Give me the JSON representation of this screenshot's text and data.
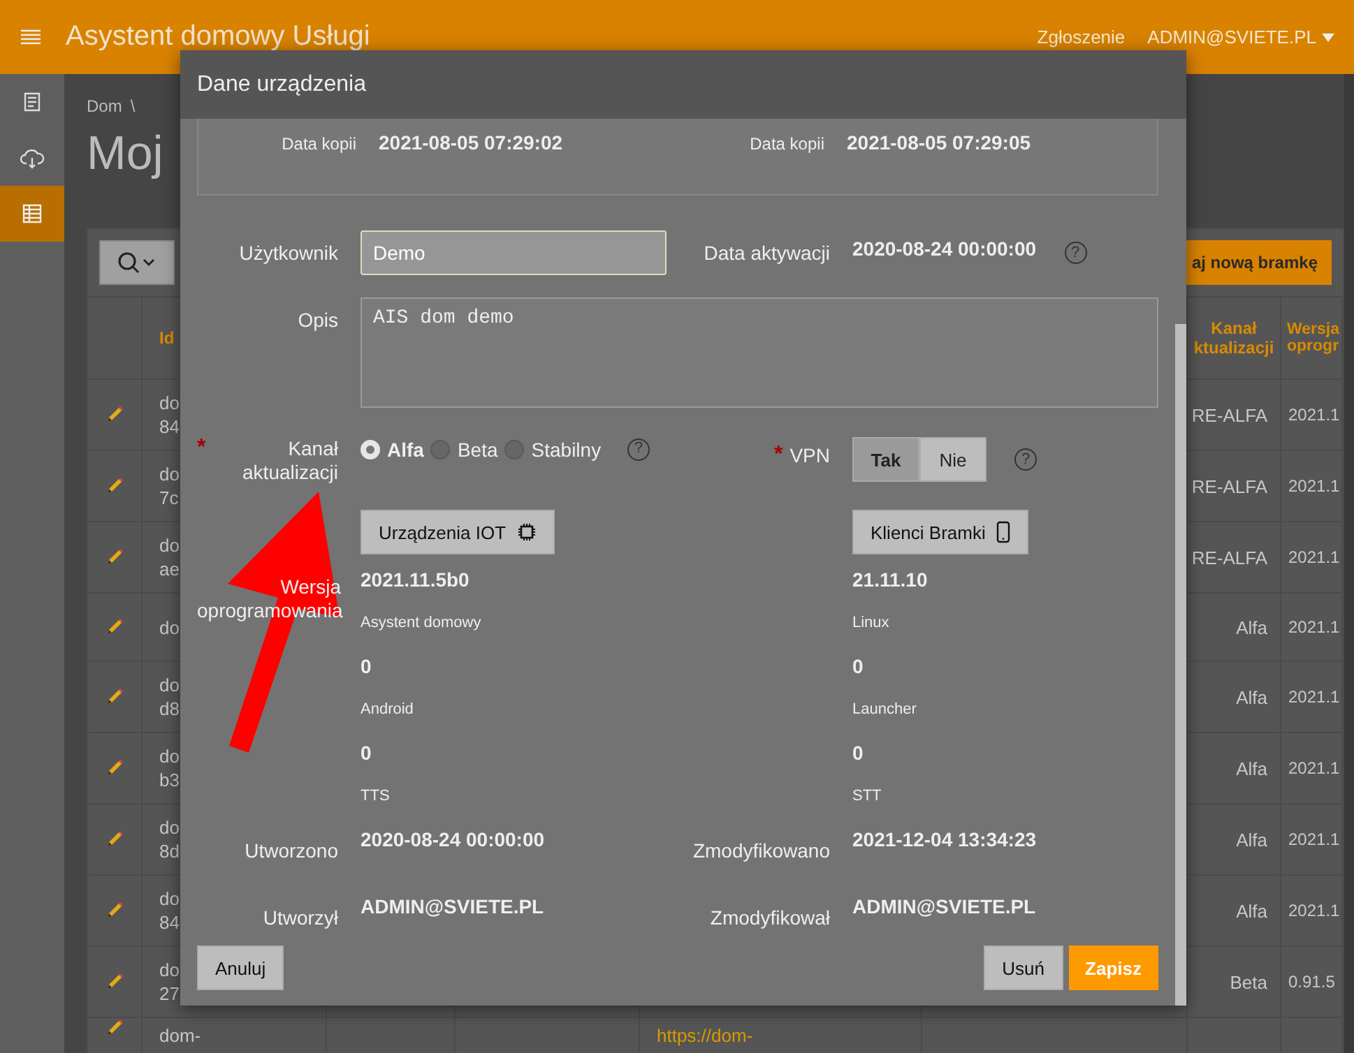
{
  "header": {
    "title": "Asystent domowy Usługi",
    "link": "Zgłoszenie",
    "user": "ADMIN@SVIETE.PL"
  },
  "sidebar": {
    "items": [
      {
        "selected": false
      },
      {
        "selected": false
      },
      {
        "selected": true
      }
    ]
  },
  "breadcrumb": {
    "item": "Dom",
    "separator": "\\"
  },
  "page_title": "Moj",
  "toolbar": {
    "add_button": "aj nową bramkę"
  },
  "table": {
    "columns": [
      "Id",
      "Kanał ktualizacji",
      "Wersja oprogr"
    ],
    "rows": [
      {
        "id": [
          "do",
          "84"
        ],
        "channel": "RE-ALFA",
        "version": "2021.1"
      },
      {
        "id": [
          "do",
          "7c"
        ],
        "channel": "RE-ALFA",
        "version": "2021.1"
      },
      {
        "id": [
          "do",
          "ae"
        ],
        "channel": "RE-ALFA",
        "version": "2021.1"
      },
      {
        "id": [
          "do"
        ],
        "channel": "Alfa",
        "version": "2021.1"
      },
      {
        "id": [
          "do",
          "d8"
        ],
        "channel": "Alfa",
        "version": "2021.1"
      },
      {
        "id": [
          "do",
          "b3"
        ],
        "channel": "Alfa",
        "version": "2021.1"
      },
      {
        "id": [
          "do",
          "8d"
        ],
        "channel": "Alfa",
        "version": "2021.1"
      },
      {
        "id": [
          "do",
          "84"
        ],
        "channel": "Alfa",
        "version": "2021.1"
      },
      {
        "id": [
          "do",
          "27"
        ],
        "channel": "Beta",
        "version": "0.91.5"
      },
      {
        "id": [
          "dom-"
        ],
        "link": "https://dom-"
      }
    ]
  },
  "dialog": {
    "title": "Dane urządzenia",
    "backup": [
      {
        "label": "Data kopii",
        "value": "2021-08-05 07:29:02"
      },
      {
        "label": "Data kopii",
        "value": "2021-08-05 07:29:05"
      }
    ],
    "user": {
      "label": "Użytkownik",
      "value": "Demo"
    },
    "activation": {
      "label": "Data aktywacji",
      "value": "2020-08-24 00:00:00",
      "help": "?"
    },
    "description": {
      "label": "Opis",
      "value": "AIS dom demo"
    },
    "channel": {
      "marker": "*",
      "label": "Kanał aktualizacji",
      "help": "?",
      "options": [
        {
          "label": "Alfa",
          "selected": true
        },
        {
          "label": "Beta",
          "selected": false
        },
        {
          "label": "Stabilny",
          "selected": false
        }
      ]
    },
    "vpn": {
      "marker": "*",
      "label": "VPN",
      "help": "?",
      "options": [
        {
          "label": "Tak",
          "selected": true
        },
        {
          "label": "Nie",
          "selected": false
        }
      ]
    },
    "iot_button": "Urządzenia IOT",
    "clients_button": "Klienci Bramki",
    "software": {
      "label": "Wersja oprogramowania",
      "items": [
        {
          "value": "2021.11.5b0",
          "name": "Asystent domowy"
        },
        {
          "value": "21.11.10",
          "name": "Linux"
        },
        {
          "value": "0",
          "name": "Android"
        },
        {
          "value": "0",
          "name": "Launcher"
        },
        {
          "value": "0",
          "name": "TTS"
        },
        {
          "value": "0",
          "name": "STT"
        }
      ]
    },
    "created": {
      "label": "Utworzono",
      "value": "2020-08-24 00:00:00"
    },
    "modified": {
      "label": "Zmodyfikowano",
      "value": "2021-12-04 13:34:23"
    },
    "created_by": {
      "label": "Utworzył",
      "value": "ADMIN@SVIETE.PL"
    },
    "modified_by": {
      "label": "Zmodyfikował",
      "value": "ADMIN@SVIETE.PL"
    },
    "buttons": {
      "cancel": "Anuluj",
      "delete": "Usuń",
      "save": "Zapisz"
    }
  }
}
